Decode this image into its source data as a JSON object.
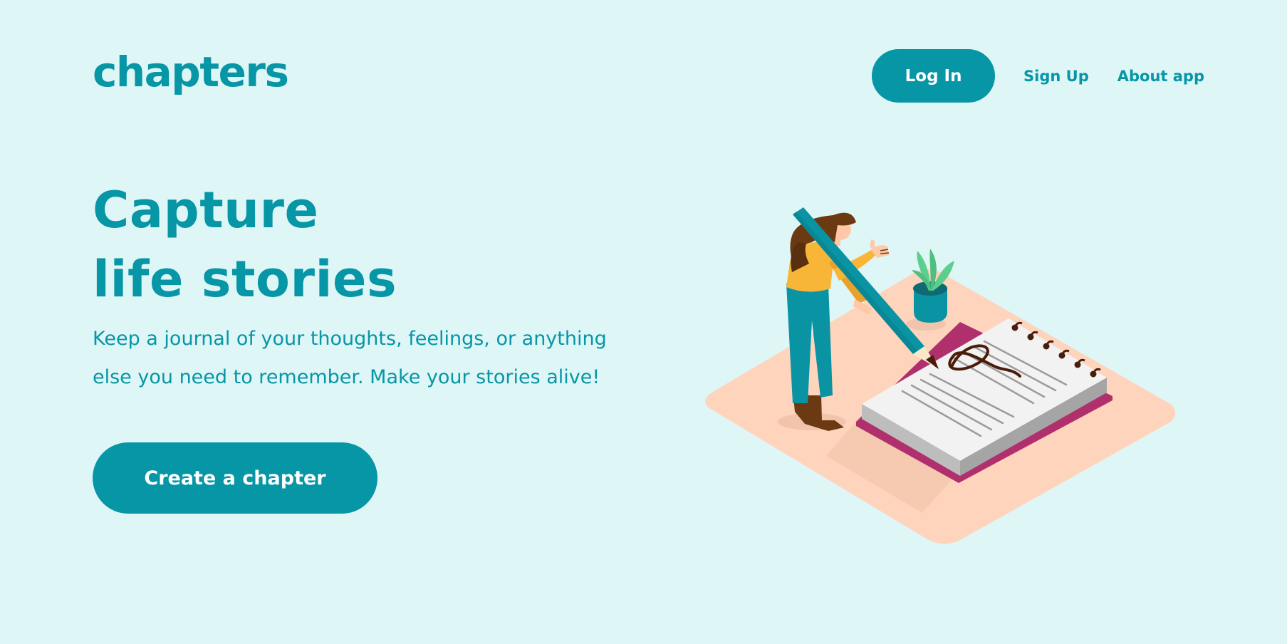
{
  "brand": {
    "logo_text": "chapters"
  },
  "nav": {
    "login_label": "Log In",
    "signup_label": "Sign Up",
    "about_label": "About app"
  },
  "hero": {
    "title_line1": "Capture",
    "title_line2": "life stories",
    "description_line1": "Keep a journal of your thoughts, feelings, or anything",
    "description_line2": "else you need to remember. Make your stories alive!",
    "cta_label": "Create a chapter"
  },
  "colors": {
    "background": "#dff6f7",
    "accent": "#0696a6",
    "button_text": "#ffffff",
    "illustration_floor": "#ffd4bd",
    "notebook_cover": "#b0306e",
    "character_shirt": "#f7b638",
    "plant_leaf": "#5ccf8f"
  },
  "illustration": {
    "name": "woman-writing-journal-illustration"
  }
}
